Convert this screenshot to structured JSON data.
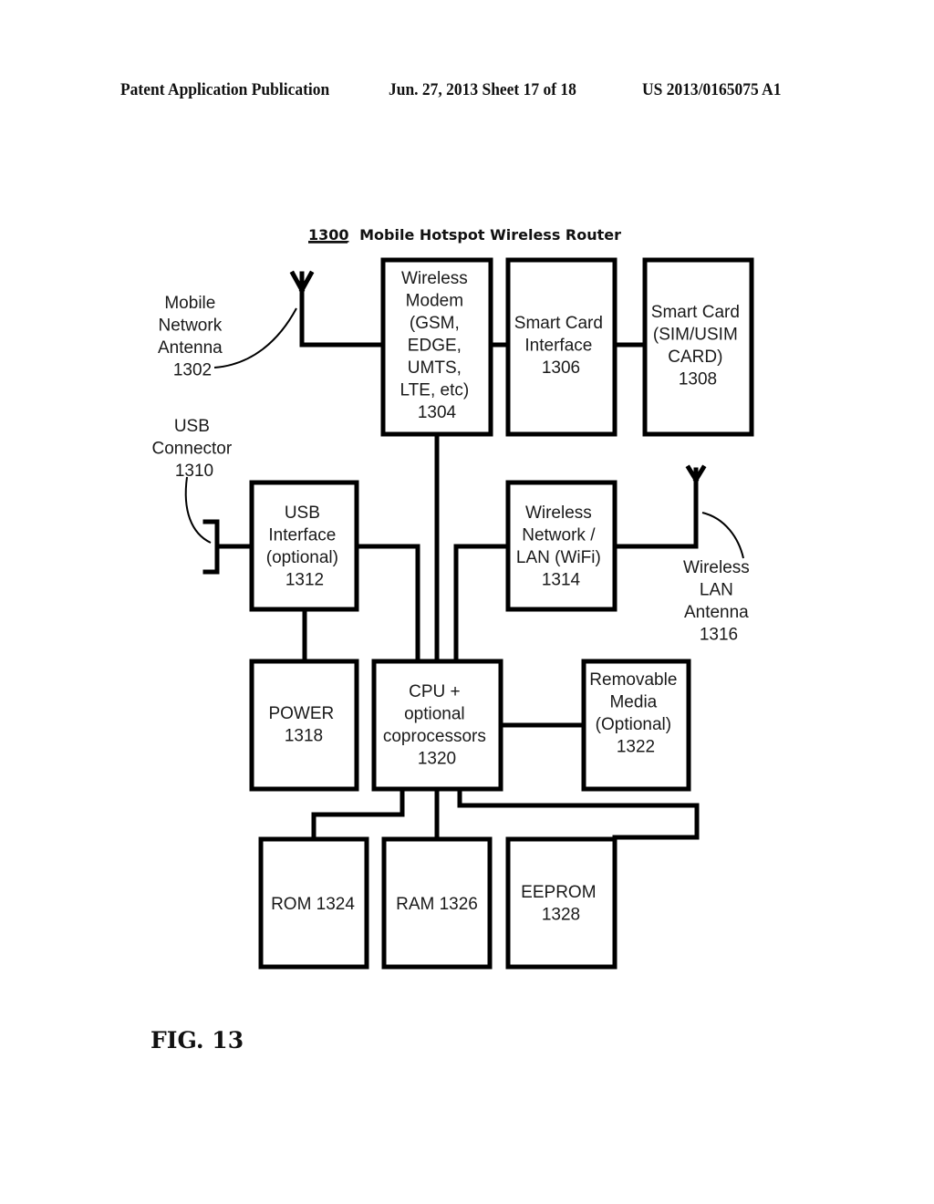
{
  "header": {
    "publication": "Patent Application Publication",
    "date_sheet": "Jun. 27, 2013  Sheet 17 of 18",
    "patent_number": "US 2013/0165075 A1"
  },
  "diagram": {
    "title_ref": "1300",
    "title": "Mobile Hotspot Wireless Router",
    "figure_label": "FIG. 13",
    "blocks": {
      "modem": [
        "Wireless",
        "Modem",
        "(GSM,",
        "EDGE,",
        "UMTS,",
        "LTE, etc)",
        "1304"
      ],
      "smart_card_interface": [
        "Smart Card",
        "Interface",
        "1306"
      ],
      "smart_card": [
        "Smart Card",
        "(SIM/USIM",
        "CARD)",
        "1308"
      ],
      "usb_interface": [
        "USB",
        "Interface",
        "(optional)",
        "1312"
      ],
      "wifi": [
        "Wireless",
        "Network /",
        "LAN (WiFi)",
        "1314"
      ],
      "power": [
        "POWER",
        "1318"
      ],
      "cpu": [
        "CPU +",
        "optional",
        "coprocessors",
        "1320"
      ],
      "removable_media": [
        "Removable",
        "Media",
        "(Optional)",
        "1322"
      ],
      "rom": [
        "ROM 1324"
      ],
      "ram": [
        "RAM 1326"
      ],
      "eeprom": [
        "EEPROM",
        "1328"
      ]
    },
    "callouts": {
      "mobile_antenna": [
        "Mobile",
        "Network",
        "Antenna",
        "1302"
      ],
      "usb_connector": [
        "USB",
        "Connector",
        "1310"
      ],
      "wlan_antenna": [
        "Wireless",
        "LAN",
        "Antenna",
        "1316"
      ]
    }
  }
}
